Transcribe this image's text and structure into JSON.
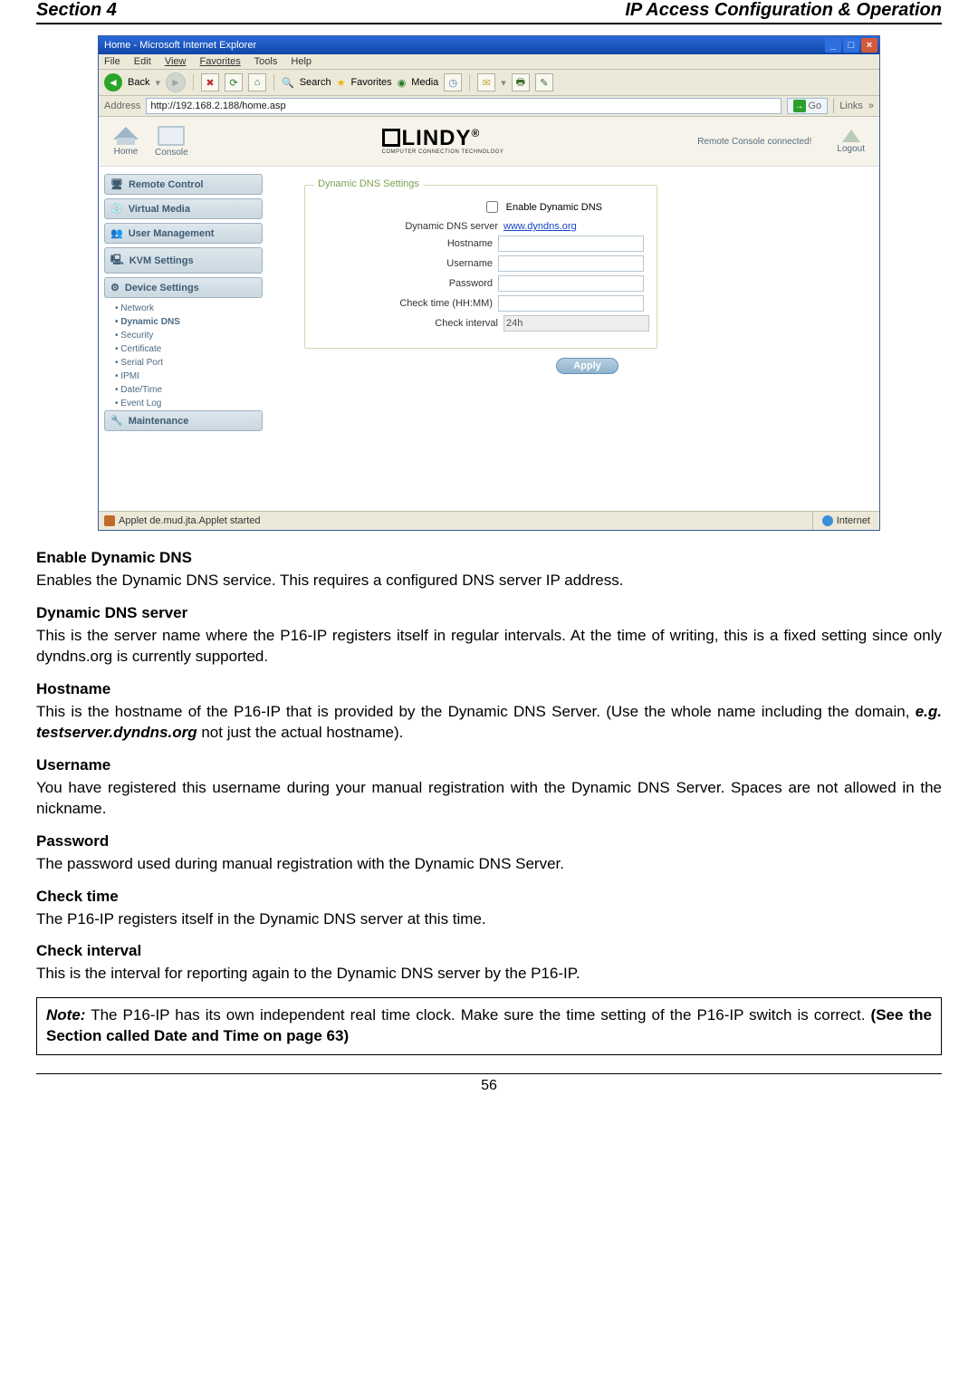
{
  "header": {
    "left": "Section 4",
    "right": "IP Access Configuration & Operation"
  },
  "browser": {
    "title": "Home - Microsoft Internet Explorer",
    "menu": [
      "File",
      "Edit",
      "View",
      "Favorites",
      "Tools",
      "Help"
    ],
    "toolbar": {
      "back": "Back",
      "search": "Search",
      "favorites": "Favorites",
      "media": "Media"
    },
    "address_label": "Address",
    "url": "http://192.168.2.188/home.asp",
    "go": "Go",
    "links": "Links",
    "status_left": "Applet de.mud.jta.Applet started",
    "status_right": "Internet"
  },
  "app": {
    "home": "Home",
    "console": "Console",
    "brand": "LINDY",
    "brand_sub": "COMPUTER CONNECTION TECHNOLOGY",
    "status": "Remote Console connected!",
    "logout": "Logout",
    "sidebar": {
      "items": [
        {
          "label": "Remote Control"
        },
        {
          "label": "Virtual Media"
        },
        {
          "label": "User Management"
        },
        {
          "label": "KVM Settings"
        },
        {
          "label": "Device Settings"
        }
      ],
      "subs": [
        {
          "label": "Network"
        },
        {
          "label": "Dynamic DNS"
        },
        {
          "label": "Security"
        },
        {
          "label": "Certificate"
        },
        {
          "label": "Serial Port"
        },
        {
          "label": "IPMI"
        },
        {
          "label": "Date/Time"
        },
        {
          "label": "Event Log"
        }
      ],
      "last": {
        "label": "Maintenance"
      }
    },
    "form": {
      "legend": "Dynamic DNS Settings",
      "enable": "Enable Dynamic DNS",
      "server_label": "Dynamic DNS server",
      "server_value": "www.dyndns.org",
      "hostname": "Hostname",
      "username": "Username",
      "password": "Password",
      "checktime": "Check time (HH:MM)",
      "checkinterval": "Check interval",
      "interval_value": "24h",
      "apply": "Apply"
    }
  },
  "doc": {
    "s1h": "Enable Dynamic DNS",
    "s1": "Enables the Dynamic DNS service. This requires a configured DNS server IP address.",
    "s2h": "Dynamic DNS server",
    "s2": "This is the server name where the P16-IP registers itself in regular intervals. At the time of writing, this is a fixed setting since only dyndns.org is currently supported.",
    "s3h": "Hostname",
    "s3a": "This is the hostname of the P16-IP that is provided by the Dynamic DNS Server. (Use the whole name including the domain, ",
    "s3b": "e.g. testserver.dyndns.org",
    "s3c": " not just the actual hostname).",
    "s4h": "Username",
    "s4": "You have registered this username during your manual registration with the Dynamic DNS Server. Spaces are not allowed in the nickname.",
    "s5h": "Password",
    "s5": "The password used during manual registration with the Dynamic DNS Server.",
    "s6h": "Check time",
    "s6": "The P16-IP registers itself in the Dynamic DNS server at this time.",
    "s7h": "Check interval",
    "s7": "This is the interval for reporting again to the Dynamic DNS server by the P16-IP.",
    "note_lead": "Note:",
    "note_a": " The P16-IP has its own independent real time clock. Make sure the time setting of the P16-IP switch is correct. ",
    "note_b": "(See the Section called Date and Time on page 63)"
  },
  "page_number": "56"
}
